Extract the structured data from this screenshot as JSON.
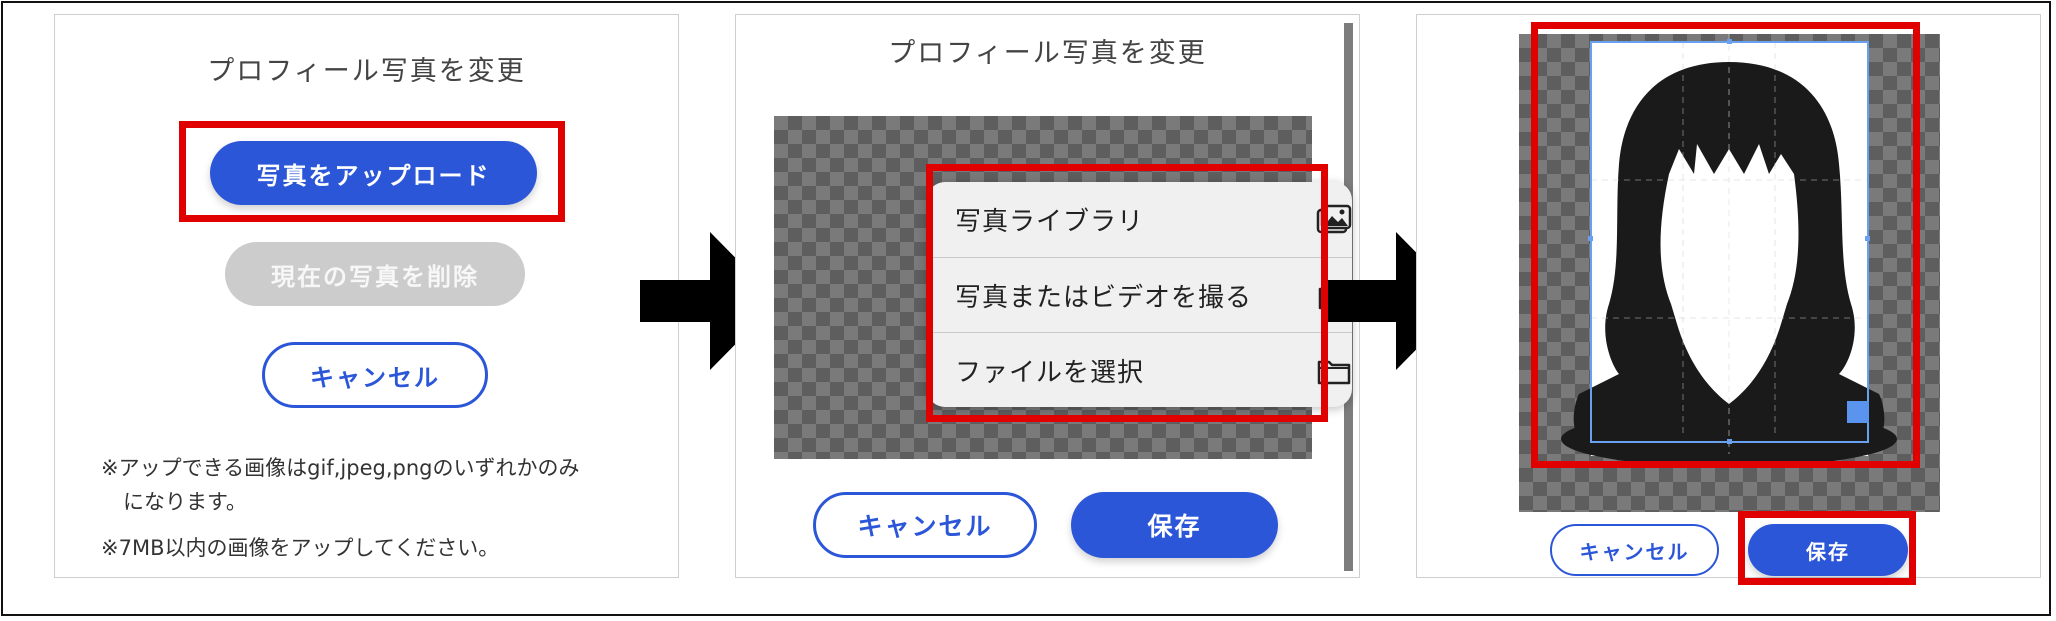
{
  "panel1": {
    "title": "プロフィール写真を変更",
    "upload_label": "写真をアップロード",
    "delete_label": "現在の写真を削除",
    "cancel_label": "キャンセル",
    "note1_line1": "※アップできる画像はgif,jpeg,pngのいずれかのみ",
    "note1_line2": "になります。",
    "note2": "※7MB以内の画像をアップしてください。"
  },
  "panel2": {
    "title": "プロフィール写真を変更",
    "menu": [
      {
        "label": "写真ライブラリ",
        "icon": "photo-library-icon"
      },
      {
        "label": "写真またはビデオを撮る",
        "icon": "camera-icon"
      },
      {
        "label": "ファイルを選択",
        "icon": "folder-icon"
      }
    ],
    "cancel_label": "キャンセル",
    "save_label": "保存"
  },
  "panel3": {
    "cancel_label": "キャンセル",
    "save_label": "保存"
  },
  "colors": {
    "accent": "#2c56d8",
    "highlight": "#e00000",
    "disabled": "#cccccc",
    "crop_frame": "#6aa0f0"
  }
}
